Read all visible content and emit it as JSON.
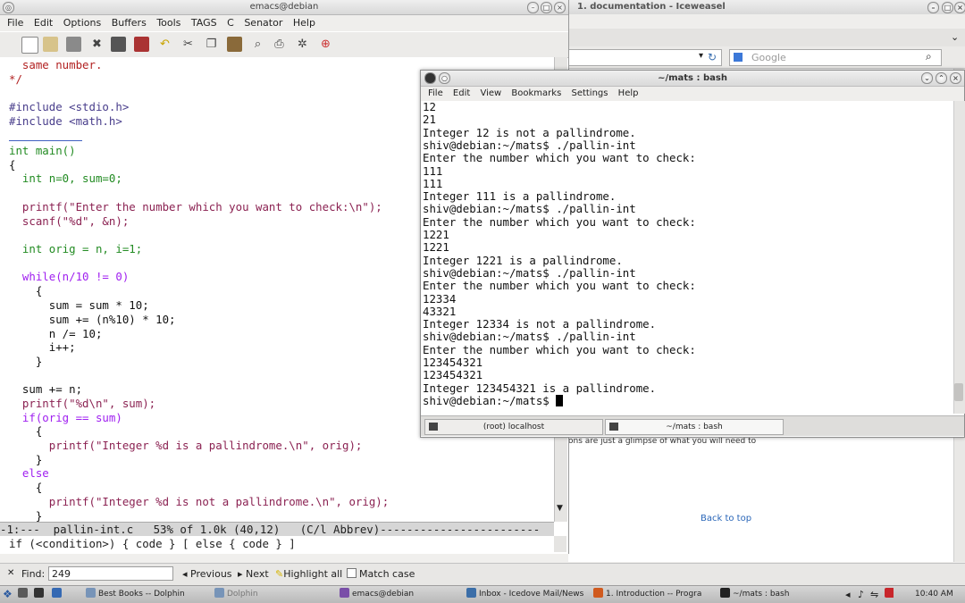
{
  "browser": {
    "title": "1. documentation - Iceweasel",
    "search_placeholder": "Google",
    "snippet": "ons are just a glimpse of what you will need to",
    "back_to_top": "Back to top",
    "find": {
      "label": "Find:",
      "value": "249",
      "previous": "Previous",
      "next": "Next",
      "highlight": "Highlight all",
      "match_case": "Match case"
    }
  },
  "emacs": {
    "title": "emacs@debian",
    "menu": [
      "File",
      "Edit",
      "Options",
      "Buffers",
      "Tools",
      "TAGS",
      "C",
      "Senator",
      "Help"
    ],
    "lines": [
      "  same number.",
      "*/",
      "",
      "#include <stdio.h>",
      "#include <math.h>",
      "",
      "int main()",
      "{",
      "  int n=0, sum=0;",
      "",
      "  printf(\"Enter the number which you want to check:\\n\");",
      "  scanf(\"%d\", &n);",
      "",
      "  int orig = n, i=1;",
      "",
      "  while(n/10 != 0)",
      "    {",
      "      sum = sum * 10;",
      "      sum += (n%10) * 10;",
      "      n /= 10;",
      "      i++;",
      "    }",
      "",
      "  sum += n;",
      "  printf(\"%d\\n\", sum);",
      "  if(orig == sum)",
      "    {",
      "      printf(\"Integer %d is a pallindrome.\\n\", orig);",
      "    }",
      "  else",
      "    {",
      "      printf(\"Integer %d is not a pallindrome.\\n\", orig);",
      "    }"
    ],
    "modeline": "-1:---  pallin-int.c   53% of 1.0k (40,12)   (C/l Abbrev)------------------------",
    "minibuffer": "if (<condition>) { code } [ else { code } ]"
  },
  "konsole": {
    "title": "~/mats : bash",
    "menu": [
      "File",
      "Edit",
      "View",
      "Bookmarks",
      "Settings",
      "Help"
    ],
    "lines": [
      "12",
      "21",
      "Integer 12 is not a pallindrome.",
      "shiv@debian:~/mats$ ./pallin-int",
      "Enter the number which you want to check:",
      "111",
      "111",
      "Integer 111 is a pallindrome.",
      "shiv@debian:~/mats$ ./pallin-int",
      "Enter the number which you want to check:",
      "1221",
      "1221",
      "Integer 1221 is a pallindrome.",
      "shiv@debian:~/mats$ ./pallin-int",
      "Enter the number which you want to check:",
      "12334",
      "43321",
      "Integer 12334 is not a pallindrome.",
      "shiv@debian:~/mats$ ./pallin-int",
      "Enter the number which you want to check:",
      "123454321",
      "123454321",
      "Integer 123454321 is a pallindrome.",
      "shiv@debian:~/mats$ "
    ],
    "tabs": [
      "(root) localhost",
      "~/mats : bash"
    ]
  },
  "taskbar": {
    "tasks": [
      "Best Books -- Dolphin",
      "Dolphin",
      "emacs@debian",
      "Inbox - Icedove Mail/News",
      "1. Introduction -- Progra",
      "~/mats : bash"
    ],
    "clock": "10:40 AM"
  }
}
